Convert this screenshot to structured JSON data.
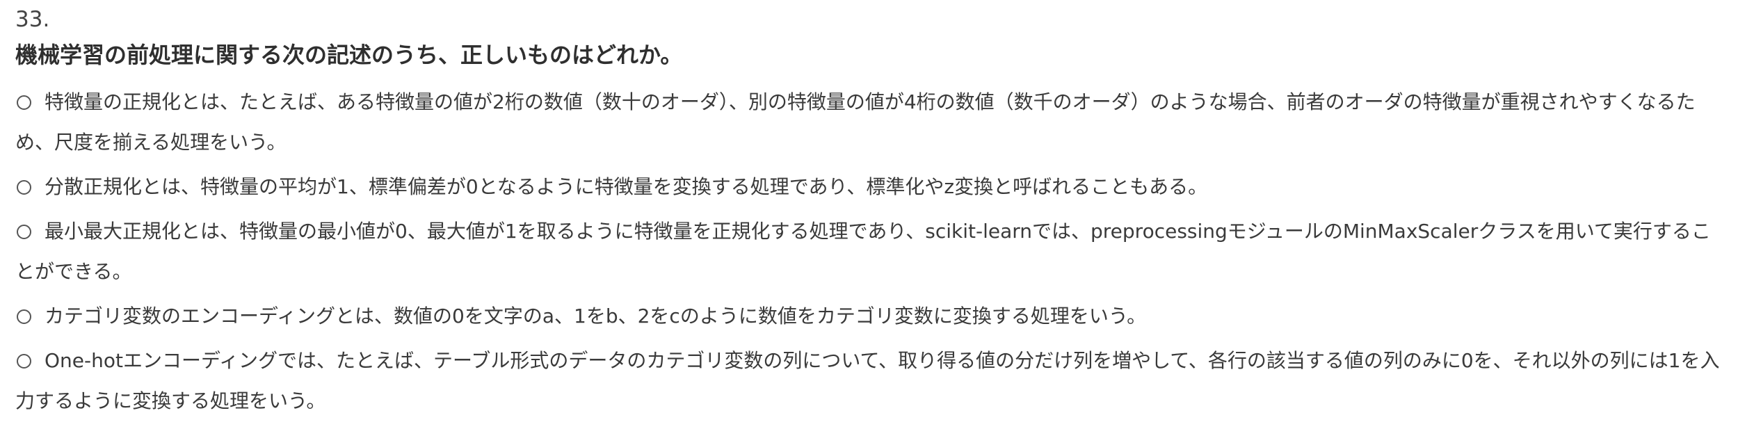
{
  "question": {
    "number": "33.",
    "text": "機械学習の前処理に関する次の記述のうち、正しいものはどれか。"
  },
  "options": [
    {
      "label": "特徴量の正規化とは、たとえば、ある特徴量の値が2桁の数値（数十のオーダ）、別の特徴量の値が4桁の数値（数千のオーダ）のような場合、前者のオーダの特徴量が重視されやすくなるため、尺度を揃える処理をいう。"
    },
    {
      "label": "分散正規化とは、特徴量の平均が1、標準偏差が0となるように特徴量を変換する処理であり、標準化やz変換と呼ばれることもある。"
    },
    {
      "label": "最小最大正規化とは、特徴量の最小値が0、最大値が1を取るように特徴量を正規化する処理であり、scikit-learnでは、preprocessingモジュールのMinMaxScalerクラスを用いて実行することができる。"
    },
    {
      "label": "カテゴリ変数のエンコーディングとは、数値の0を文字のa、1をb、2をcのように数値をカテゴリ変数に変換する処理をいう。"
    },
    {
      "label": "One-hotエンコーディングでは、たとえば、テーブル形式のデータのカテゴリ変数の列について、取り得る値の分だけ列を増やして、各行の該当する値の列のみに0を、それ以外の列には1を入力するように変換する処理をいう。"
    }
  ]
}
